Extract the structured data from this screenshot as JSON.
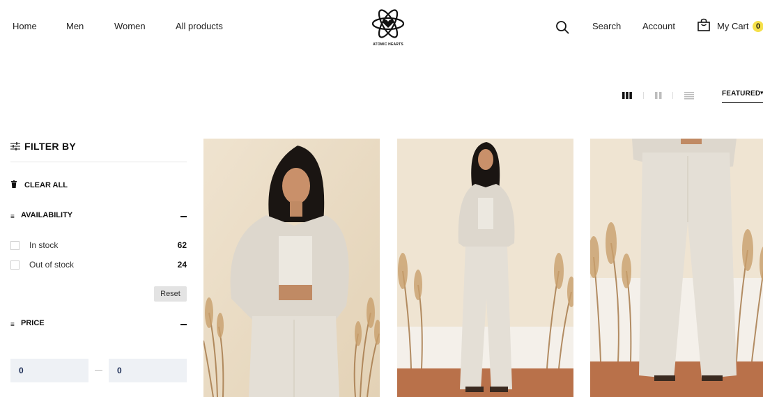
{
  "header": {
    "nav": [
      {
        "label": "Home"
      },
      {
        "label": "Men"
      },
      {
        "label": "Women"
      },
      {
        "label": "All products"
      }
    ],
    "logo_text": "ATOMIC HEARTS",
    "search_label": "Search",
    "account_label": "Account",
    "cart_label": "My Cart",
    "cart_count": "0"
  },
  "toolbar": {
    "views": [
      "grid-3-icon",
      "grid-2-icon",
      "list-icon"
    ],
    "sort_label": "FEATURED"
  },
  "filters": {
    "title": "FILTER BY",
    "clear_all": "CLEAR ALL",
    "availability": {
      "label": "AVAILABILITY",
      "options": [
        {
          "label": "In stock",
          "count": "62"
        },
        {
          "label": "Out of stock",
          "count": "24"
        }
      ],
      "reset_label": "Reset"
    },
    "price": {
      "label": "PRICE",
      "min_value": "0",
      "max_value": "0"
    }
  },
  "colors": {
    "accent_yellow": "#f5e04a",
    "input_bg": "#eef1f5",
    "reset_bg": "#e3e3e3"
  }
}
